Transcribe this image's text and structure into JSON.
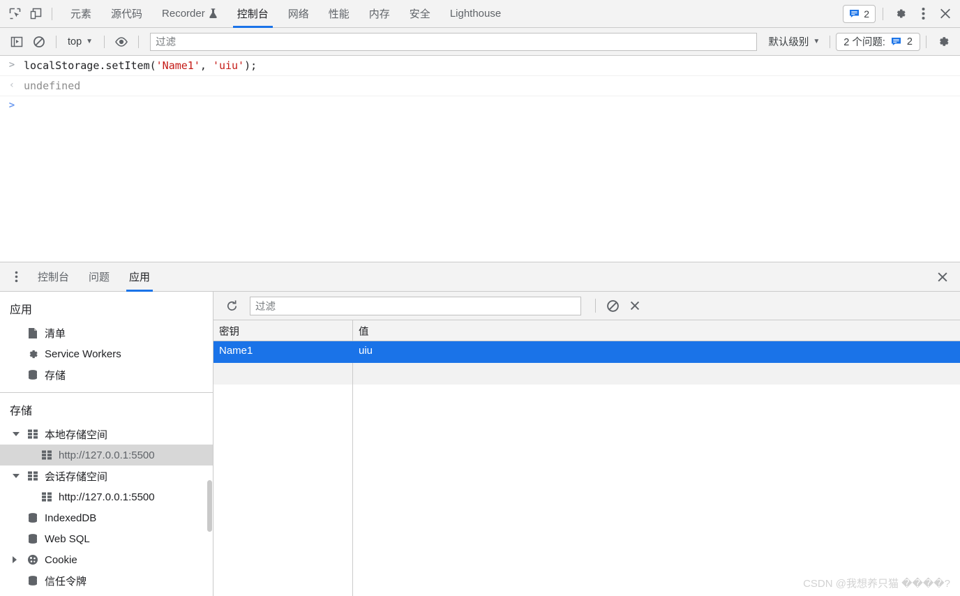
{
  "main_tabbar": {
    "inspect_icon": "inspect-cursor-icon",
    "device_toggle_icon": "device-toolbar-icon",
    "tabs": [
      {
        "label": "元素",
        "active": false
      },
      {
        "label": "源代码",
        "active": false
      },
      {
        "label": "Recorder",
        "active": false,
        "icon": "experiment-flask-icon"
      },
      {
        "label": "控制台",
        "active": true
      },
      {
        "label": "网络",
        "active": false
      },
      {
        "label": "性能",
        "active": false
      },
      {
        "label": "内存",
        "active": false
      },
      {
        "label": "安全",
        "active": false
      },
      {
        "label": "Lighthouse",
        "active": false
      }
    ],
    "issues_count": "2",
    "settings_icon": "gear-icon",
    "more_icon": "kebab-menu-icon",
    "close_icon": "close-icon"
  },
  "console_toolbar": {
    "sidebar_toggle_icon": "console-sidebar-icon",
    "clear_icon": "clear-console-icon",
    "context": "top",
    "eye_icon": "live-expression-eye-icon",
    "filter_placeholder": "过滤",
    "filter_value": "",
    "level": "默认级别",
    "issues_label": "2 个问题:",
    "issues_count": "2",
    "settings_icon": "gear-icon"
  },
  "console_log": [
    {
      "gutter": ">",
      "type": "input",
      "parts": [
        {
          "text": "localStorage.setItem(",
          "cls": "plain"
        },
        {
          "text": "'Name1'",
          "cls": "str"
        },
        {
          "text": ", ",
          "cls": "plain"
        },
        {
          "text": "'uiu'",
          "cls": "str"
        },
        {
          "text": ");",
          "cls": "plain"
        }
      ]
    },
    {
      "gutter": "‹",
      "type": "output",
      "parts": [
        {
          "text": "undefined",
          "cls": "undef"
        }
      ]
    }
  ],
  "console_prompt": {
    "gutter": ">",
    "value": ""
  },
  "drawer": {
    "more_icon": "kebab-menu-icon",
    "tabs": [
      {
        "label": "控制台",
        "active": false
      },
      {
        "label": "问题",
        "active": false
      },
      {
        "label": "应用",
        "active": true
      }
    ],
    "close_icon": "close-icon"
  },
  "app_sidebar": {
    "sections": [
      {
        "title": "应用",
        "items": [
          {
            "label": "清单",
            "icon": "manifest-document-icon",
            "indent": 1,
            "arrow": "none",
            "selected": false
          },
          {
            "label": "Service Workers",
            "icon": "gear-icon",
            "indent": 1,
            "arrow": "none",
            "selected": false
          },
          {
            "label": "存储",
            "icon": "database-icon",
            "indent": 1,
            "arrow": "none",
            "selected": false
          }
        ]
      },
      {
        "title": "存储",
        "items": [
          {
            "label": "本地存储空间",
            "icon": "table-grid-icon",
            "indent": 1,
            "arrow": "down",
            "selected": false
          },
          {
            "label": "http://127.0.0.1:5500",
            "icon": "table-grid-icon",
            "indent": 2,
            "arrow": "none",
            "selected": true
          },
          {
            "label": "会话存储空间",
            "icon": "table-grid-icon",
            "indent": 1,
            "arrow": "down",
            "selected": false
          },
          {
            "label": "http://127.0.0.1:5500",
            "icon": "table-grid-icon",
            "indent": 2,
            "arrow": "none",
            "selected": false
          },
          {
            "label": "IndexedDB",
            "icon": "database-icon",
            "indent": 1,
            "arrow": "none",
            "selected": false
          },
          {
            "label": "Web SQL",
            "icon": "database-icon",
            "indent": 1,
            "arrow": "none",
            "selected": false
          },
          {
            "label": "Cookie",
            "icon": "cookie-icon",
            "indent": 1,
            "arrow": "right",
            "selected": false
          },
          {
            "label": "信任令牌",
            "icon": "database-icon",
            "indent": 1,
            "arrow": "none",
            "selected": false
          }
        ]
      }
    ]
  },
  "storage_toolbar": {
    "refresh_icon": "refresh-icon",
    "filter_placeholder": "过滤",
    "filter_value": "",
    "clear_all_icon": "clear-all-icon",
    "delete_icon": "delete-selected-icon"
  },
  "storage_table": {
    "columns": [
      "密钥",
      "值"
    ],
    "rows": [
      {
        "key": "Name1",
        "value": "uiu",
        "selected": true
      }
    ]
  },
  "watermark": "CSDN @我想养只猫 ����?",
  "colors": {
    "accent": "#1a73e8",
    "toolbar_bg": "#f3f3f3",
    "border": "#cacaca",
    "selected_row": "#1a73e8",
    "inactive_selection": "#d7d7d7",
    "string_literal": "#c41a16",
    "undefined_text": "#8c8c8c"
  }
}
